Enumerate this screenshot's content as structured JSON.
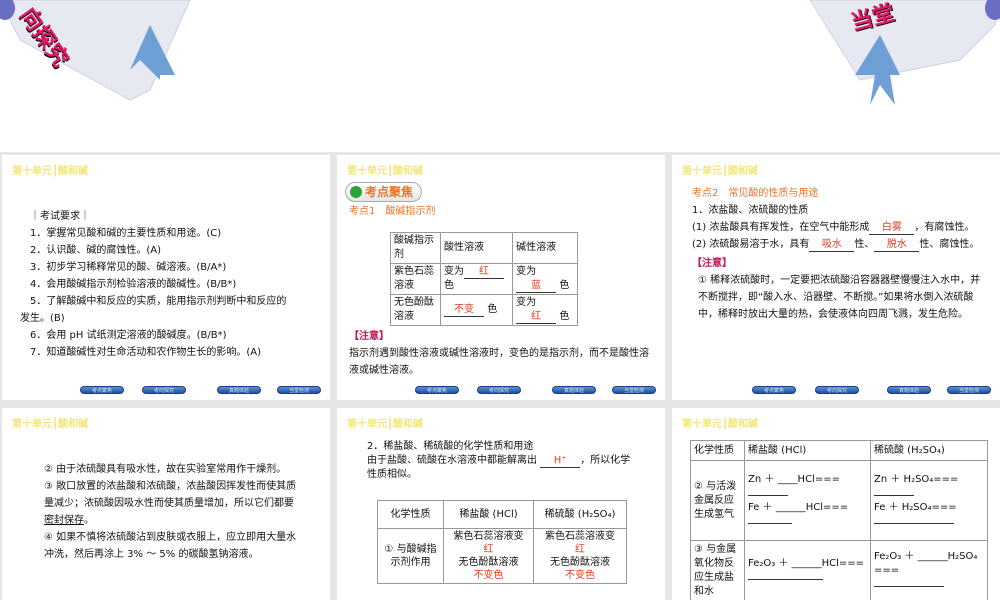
{
  "banner": {
    "left_text": "向探究",
    "right_text": "当堂"
  },
  "header": "第十单元┃酸和碱",
  "nav": [
    "考点聚焦",
    "考向探究",
    "真题体验",
    "当堂检测"
  ],
  "slide1": {
    "title": "｜考试要求｜",
    "items": [
      "1．掌握常见酸和碱的主要性质和用途。(C)",
      "2．认识酸、碱的腐蚀性。(A)",
      "3．初步学习稀释常见的酸、碱溶液。(B/A*)",
      "4．会用酸碱指示剂检验溶液的酸碱性。(B/B*)",
      "5．了解酸碱中和反应的实质，能用指示剂判断中和反应的",
      "发生。(B)",
      "6．会用 pH 试纸测定溶液的酸碱度。(B/B*)",
      "7．知道酸碱性对生命活动和农作物生长的影响。(A)"
    ]
  },
  "slide2": {
    "badge": "考点聚焦",
    "heading": "考点1　酸碱指示剂",
    "table": {
      "headers": [
        "酸碱指示剂",
        "酸性溶液",
        "碱性溶液"
      ],
      "rows": [
        {
          "name": "紫色石蕊溶液",
          "acid_pre": "变为",
          "acid_ans": "红",
          "acid_post": "色",
          "base_pre": "变为",
          "base_ans": "蓝",
          "base_post": "色"
        },
        {
          "name": "无色酚酞溶液",
          "acid_pre": "",
          "acid_ans": "不变",
          "acid_post": "色",
          "base_pre": "变为",
          "base_ans": "红",
          "base_post": "色"
        }
      ]
    },
    "note_title": "【注意】",
    "note": "指示剂遇到酸性溶液或碱性溶液时，变色的是指示剂，而不是酸性溶液或碱性溶液。"
  },
  "slide3": {
    "heading": "考点2　常见酸的性质与用途",
    "sub": "1．浓盐酸、浓硫酸的性质",
    "p1_pre": "(1) 浓盐酸具有挥发性，在空气中能形成",
    "p1_ans": "白雾",
    "p1_post": "，有腐蚀性。",
    "p2_pre": "(2) 浓硫酸易溶于水，具有",
    "p2_ans1": "吸水",
    "p2_mid": "性、",
    "p2_ans2": "脱水",
    "p2_post": "性、腐蚀性。",
    "note_title": "【注意】",
    "note": "① 稀释浓硫酸时，一定要把浓硫酸沿容器器壁慢慢注入水中，并不断搅拌，即“酸入水、沿器壁、不断搅。”如果将水倒入浓硫酸中，稀释时放出大量的热，会使液体向四周飞溅，发生危险。"
  },
  "slide4": {
    "p2": "② 由于浓硫酸具有吸水性，故在实验室常用作干燥剂。",
    "p3_pre": "③ 敞口放置的浓盐酸和浓硫酸，浓盐酸因挥发性而使其质量减少；浓硫酸因吸水性而使其质量增加，所以它们都要",
    "p3_ul": "密封保存",
    "p3_post": "。",
    "p4": "④ 如果不慎将浓硫酸沾到皮肤或衣服上，应立即用大量水冲洗，然后再涂上 3% ～ 5% 的碳酸氢钠溶液。"
  },
  "slide5": {
    "title": "2．稀盐酸、稀硫酸的化学性质和用途",
    "intro_pre": "由于盐酸、硫酸在水溶液中都能解离出",
    "intro_ans": "H⁺",
    "intro_post": "，所以化学性质相似。",
    "headers": [
      "化学性质",
      "稀盐酸 (HCl)",
      "稀硫酸 (H₂SO₄)"
    ],
    "row_name": "① 与酸碱指示剂作用",
    "hcl": [
      "紫色石蕊溶液变",
      "无色酚酞溶液"
    ],
    "h2so4": [
      "紫色石蕊溶液变",
      "无色酚酞溶液"
    ],
    "ans_red": "红",
    "ans_nochange": "不变色"
  },
  "slide6": {
    "headers": [
      "化学性质",
      "稀盐酸 (HCl)",
      "稀硫酸 (H₂SO₄)"
    ],
    "rows": [
      {
        "name": "② 与活泼金属反应生成氢气",
        "hcl": [
          "Zn ＋ ____HCl===",
          "Fe ＋ ______HCl==="
        ],
        "h2so4": [
          "Zn ＋ H₂SO₄===",
          "Fe ＋ H₂SO₄==="
        ]
      },
      {
        "name": "③ 与金属氧化物反应生成盐和水",
        "hcl": [
          "Fe₂O₃ ＋ ______HCl==="
        ],
        "h2so4": [
          "Fe₂O₃ ＋ ______H₂SO₄ ==="
        ]
      }
    ]
  }
}
